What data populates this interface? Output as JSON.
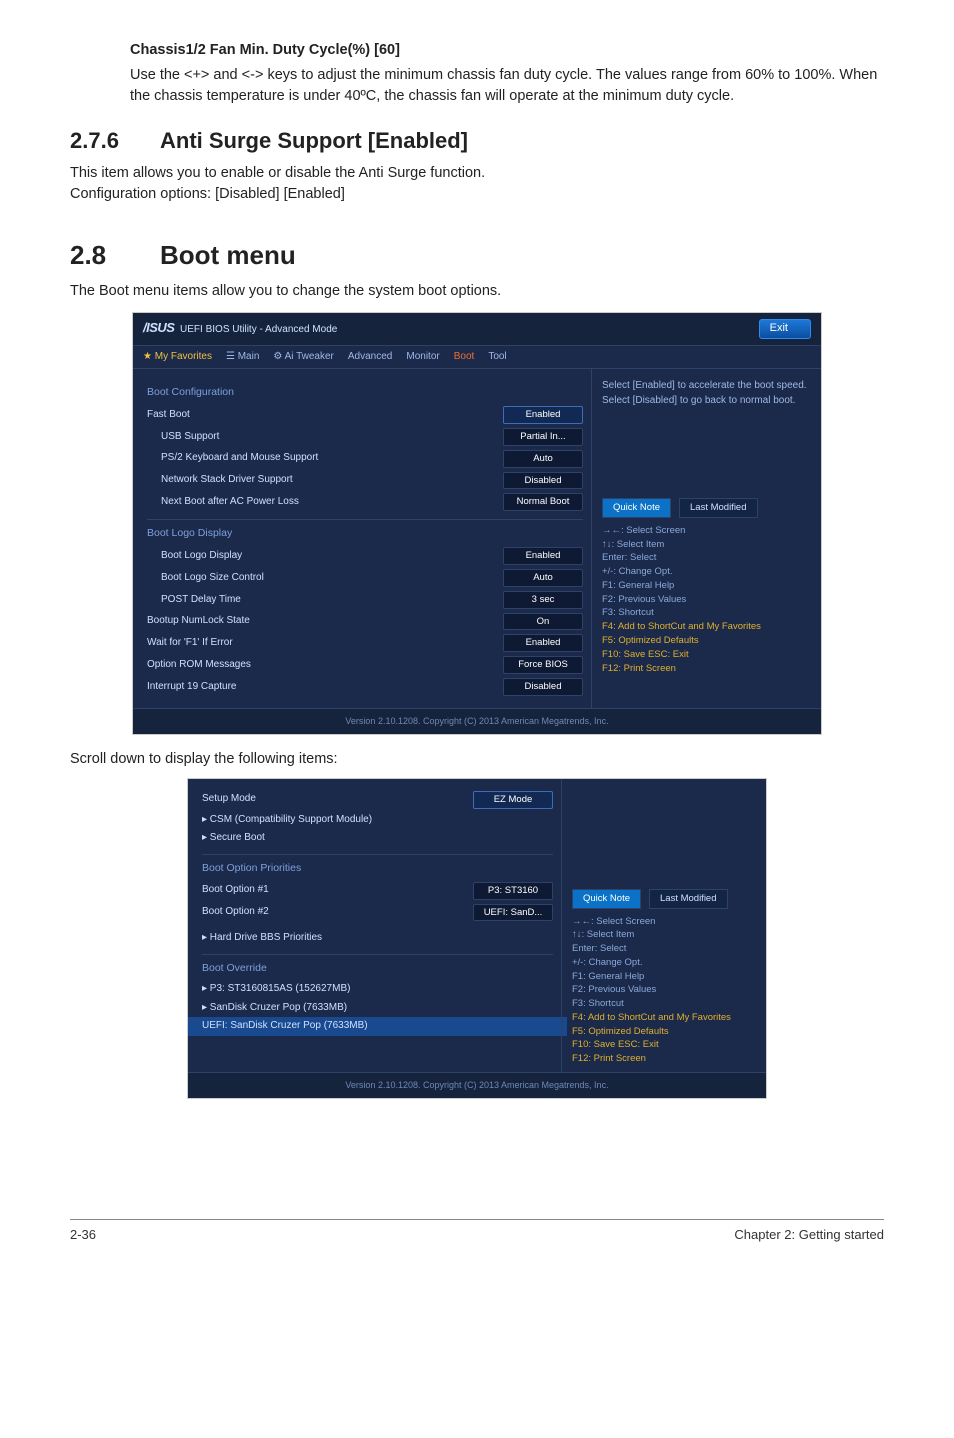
{
  "sec_fan": {
    "heading": "Chassis1/2 Fan Min. Duty Cycle(%) [60]",
    "para": "Use the <+> and <-> keys to adjust the minimum chassis fan duty cycle. The values range from 60% to 100%. When the chassis temperature is under 40ºC, the chassis fan will operate at the minimum duty cycle."
  },
  "sec_276": {
    "num": "2.7.6",
    "title": "Anti Surge Support [Enabled]",
    "p1": "This item allows you to enable or disable the Anti Surge function.",
    "p2": "Configuration options: [Disabled] [Enabled]"
  },
  "sec_28": {
    "num": "2.8",
    "title": "Boot menu",
    "p1": "The Boot menu items allow you to change the system boot options."
  },
  "bios1": {
    "title": "UEFI BIOS Utility - Advanced Mode",
    "exit": "Exit",
    "menu": {
      "fav": "★ My Favorites",
      "main": "☰ Main",
      "tweak": "⚙ Ai Tweaker",
      "adv": "Advanced",
      "mon": "Monitor",
      "boot": "Boot",
      "tool": "Tool"
    },
    "grp_bootcfg": "Boot Configuration",
    "rows": {
      "fastboot_l": "Fast Boot",
      "fastboot_v": "Enabled",
      "usb_l": "USB Support",
      "usb_v": "Partial In...",
      "ps2_l": "PS/2 Keyboard and Mouse Support",
      "ps2_v": "Auto",
      "net_l": "Network Stack Driver Support",
      "net_v": "Disabled",
      "nxt_l": "Next Boot after AC Power Loss",
      "nxt_v": "Normal Boot"
    },
    "grp_logo": "Boot Logo Display",
    "rows2": {
      "logo_l": "Boot Logo Display",
      "logo_v": "Enabled",
      "size_l": "Boot Logo Size Control",
      "size_v": "Auto",
      "delay_l": "POST Delay Time",
      "delay_v": "3 sec",
      "numlock_l": "Bootup NumLock State",
      "numlock_v": "On",
      "waitf1_l": "Wait for 'F1' If Error",
      "waitf1_v": "Enabled",
      "rom_l": "Option ROM Messages",
      "rom_v": "Force BIOS",
      "int19_l": "Interrupt 19 Capture",
      "int19_v": "Disabled"
    },
    "helptext": "Select [Enabled] to accelerate the boot speed. Select [Disabled] to go back to normal boot.",
    "tabs": {
      "quick": "Quick Note",
      "last": "Last Modified"
    },
    "keys": {
      "k1": "→←: Select Screen",
      "k2": "↑↓: Select Item",
      "k3": "Enter: Select",
      "k4": "+/-: Change Opt.",
      "k5": "F1: General Help",
      "k6": "F2: Previous Values",
      "k7": "F3: Shortcut",
      "k8": "F4: Add to ShortCut and My Favorites",
      "k9": "F5: Optimized Defaults",
      "k10": "F10: Save   ESC: Exit",
      "k11": "F12: Print Screen"
    },
    "footer": "Version 2.10.1208. Copyright (C) 2013 American Megatrends, Inc."
  },
  "caption2": "Scroll down to display the following items:",
  "bios2": {
    "rows": {
      "setup_l": "Setup Mode",
      "setup_v": "EZ Mode",
      "csm_l": "▸ CSM (Compatibility Support Module)",
      "secure_l": "▸ Secure Boot"
    },
    "grp_pri": "Boot Option Priorities",
    "rows2": {
      "b1_l": "Boot Option #1",
      "b1_v": "P3: ST3160",
      "b2_l": "Boot Option #2",
      "b2_v": "UEFI: SanD..."
    },
    "hdd_l": "▸ Hard Drive BBS Priorities",
    "grp_ovr": "Boot Override",
    "ov1": "▸ P3: ST3160815AS (152627MB)",
    "ov2": "▸ SanDisk Cruzer Pop (7633MB)",
    "ov3": "UEFI: SanDisk Cruzer Pop (7633MB)",
    "tabs": {
      "quick": "Quick Note",
      "last": "Last Modified"
    },
    "keys": {
      "k1": "→←: Select Screen",
      "k2": "↑↓: Select Item",
      "k3": "Enter: Select",
      "k4": "+/-: Change Opt.",
      "k5": "F1: General Help",
      "k6": "F2: Previous Values",
      "k7": "F3: Shortcut",
      "k8": "F4: Add to ShortCut and My Favorites",
      "k9": "F5: Optimized Defaults",
      "k10": "F10: Save   ESC: Exit",
      "k11": "F12: Print Screen"
    },
    "footer": "Version 2.10.1208. Copyright (C) 2013 American Megatrends, Inc."
  },
  "pagefoot": {
    "left": "2-36",
    "right": "Chapter 2: Getting started"
  }
}
